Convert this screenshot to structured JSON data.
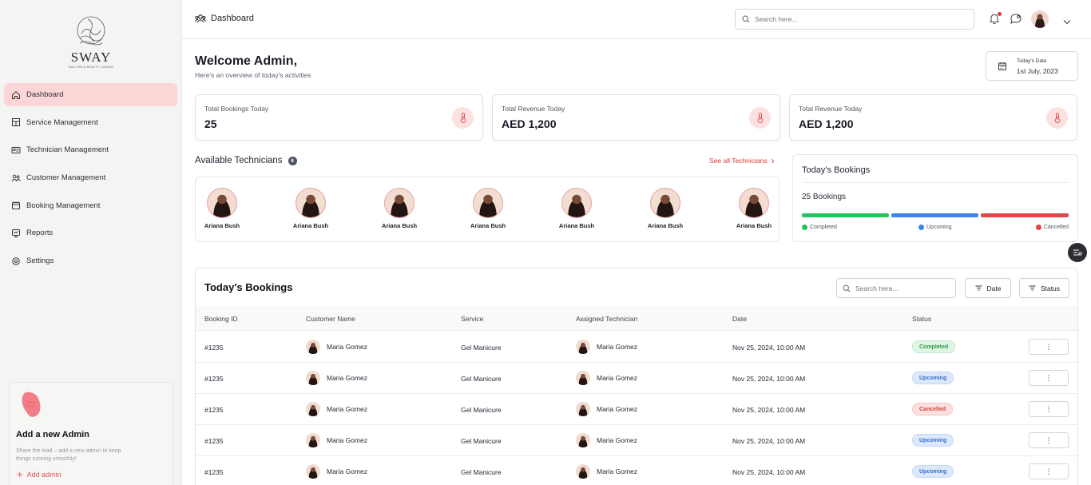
{
  "brand": {
    "name": "SWAY",
    "tagline": "NAIL SPA & BEAUTY LOUNGE"
  },
  "sidebar": {
    "items": [
      {
        "label": "Dashboard",
        "icon": "home-icon",
        "active": true
      },
      {
        "label": "Service Management",
        "icon": "building-icon",
        "active": false
      },
      {
        "label": "Technician Management",
        "icon": "id-card-icon",
        "active": false
      },
      {
        "label": "Customer Management",
        "icon": "users-icon",
        "active": false
      },
      {
        "label": "Booking Management",
        "icon": "calendar-icon",
        "active": false
      },
      {
        "label": "Reports",
        "icon": "report-icon",
        "active": false
      },
      {
        "label": "Settings",
        "icon": "gear-icon",
        "active": false
      }
    ],
    "admin_card": {
      "title": "Add a new Admin",
      "subtitle": "Share the load – add a new admin to keep things running smoothly!",
      "link": "Add admin"
    }
  },
  "topbar": {
    "title": "Dashboard",
    "search_placeholder": "Search here..."
  },
  "welcome": {
    "title": "Welcome Admin,",
    "subtitle": "Here's an overview of today's activities"
  },
  "today": {
    "label": "Today's Date",
    "value": "1st July, 2023"
  },
  "stats": [
    {
      "label": "Total Bookings Today",
      "value": "25"
    },
    {
      "label": "Total Revenue Today",
      "value": "AED 1,200"
    },
    {
      "label": "Total Revenue Today",
      "value": "AED 1,200"
    }
  ],
  "technicians": {
    "title": "Available Technicians",
    "count": "8",
    "see_all": "See all Technicians",
    "list": [
      "Ariana Bush",
      "Ariana Bush",
      "Ariana Bush",
      "Ariana Bush",
      "Ariana Bush",
      "Ariana Bush",
      "Ariana Bush"
    ]
  },
  "todays_bookings_card": {
    "title": "Today's Bookings",
    "count": "25 Bookings",
    "legend": [
      {
        "label": "Completed",
        "color": "#22c55e",
        "share": 0.333
      },
      {
        "label": "Upcoming",
        "color": "#3b82f6",
        "share": 0.333
      },
      {
        "label": "Cancelled",
        "color": "#e24646",
        "share": 0.333
      }
    ]
  },
  "bookings_table": {
    "title": "Today's Bookings",
    "search_placeholder": "Search here...",
    "filter_date": "Date",
    "filter_status": "Status",
    "columns": [
      "Booking ID",
      "Customer Name",
      "Service",
      "Assigned Technician",
      "Date",
      "Status"
    ],
    "rows": [
      {
        "id": "#1235",
        "customer": "Maria Gomez",
        "service": "Gel Manicure",
        "technician": "Maria Gomez",
        "date": "Nov 25, 2024, 10:00 AM",
        "status": "Completed",
        "status_key": "completed"
      },
      {
        "id": "#1235",
        "customer": "Maria Gomez",
        "service": "Gel Manicure",
        "technician": "Maria Gomez",
        "date": "Nov 25, 2024, 10:00 AM",
        "status": "Upcoming",
        "status_key": "upcoming"
      },
      {
        "id": "#1235",
        "customer": "Maria Gomez",
        "service": "Gel Manicure",
        "technician": "Maria Gomez",
        "date": "Nov 25, 2024, 10:00 AM",
        "status": "Cancelled",
        "status_key": "cancelled"
      },
      {
        "id": "#1235",
        "customer": "Maria Gomez",
        "service": "Gel Manicure",
        "technician": "Maria Gomez",
        "date": "Nov 25, 2024, 10:00 AM",
        "status": "Upcoming",
        "status_key": "upcoming"
      },
      {
        "id": "#1235",
        "customer": "Maria Gomez",
        "service": "Gel Manicure",
        "technician": "Maria Gomez",
        "date": "Nov 25, 2024, 10:00 AM",
        "status": "Upcoming",
        "status_key": "upcoming"
      }
    ],
    "more_label": "⋮"
  }
}
